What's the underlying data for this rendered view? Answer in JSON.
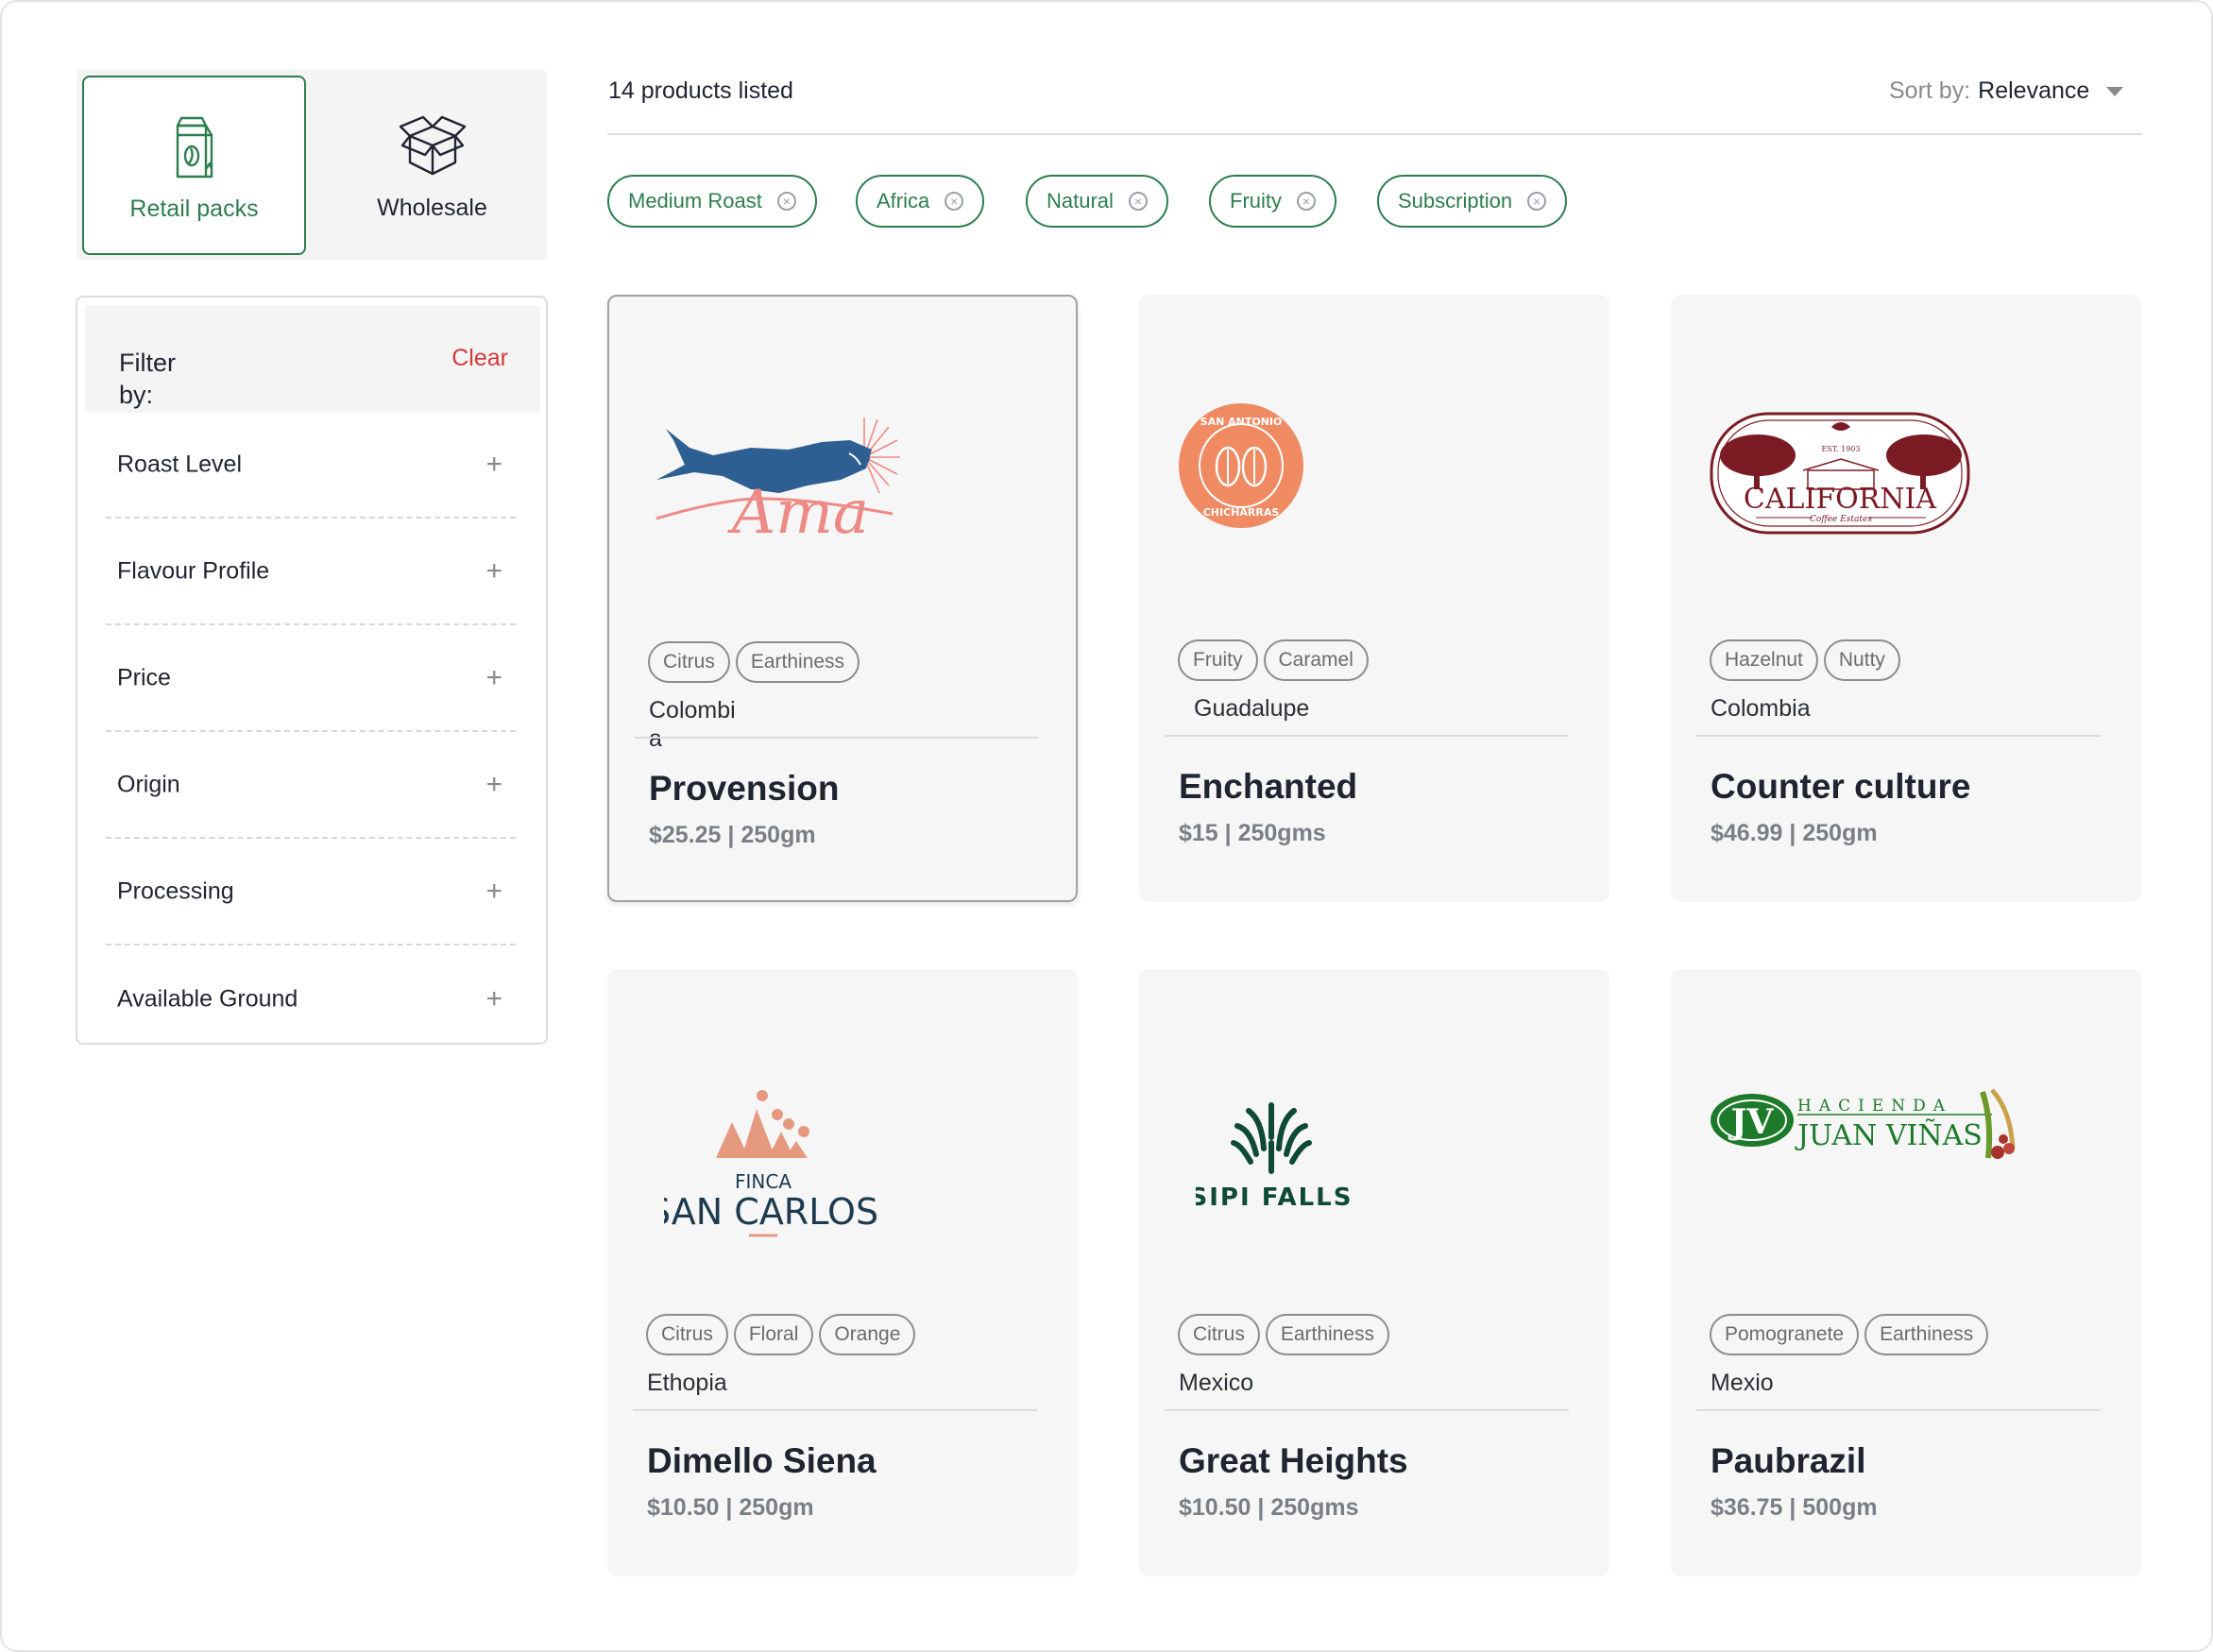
{
  "toggle": {
    "retail_label": "Retail packs",
    "wholesale_label": "Wholesale"
  },
  "filter": {
    "title": "Filter by:",
    "clear_label": "Clear",
    "items": [
      {
        "label": "Roast Level"
      },
      {
        "label": "Flavour Profile"
      },
      {
        "label": "Price"
      },
      {
        "label": "Origin"
      },
      {
        "label": "Processing"
      },
      {
        "label": "Available Ground"
      }
    ],
    "expand_icon": "+"
  },
  "results": {
    "count_text": "14 products listed",
    "sort_label": "Sort by:",
    "sort_value": "Relevance"
  },
  "active_filters": [
    {
      "label": "Medium Roast"
    },
    {
      "label": "Africa"
    },
    {
      "label": "Natural"
    },
    {
      "label": "Fruity"
    },
    {
      "label": "Subscription"
    }
  ],
  "products": [
    {
      "name": "Provension",
      "price": "$25.25 | 250gm",
      "origin": "Colombia",
      "tags": [
        "Citrus",
        "Earthiness"
      ],
      "logo": "ama-logo",
      "selected": true
    },
    {
      "name": "Enchanted",
      "price": "$15 | 250gms",
      "origin": "Guadalupe",
      "tags": [
        "Fruity",
        "Caramel"
      ],
      "logo": "san-antonio-chicharras-logo"
    },
    {
      "name": "Counter culture",
      "price": "$46.99 | 250gm",
      "origin": "Colombia",
      "tags": [
        "Hazelnut",
        "Nutty"
      ],
      "logo": "california-coffee-estates-logo"
    },
    {
      "name": "Dimello Siena",
      "price": "$10.50 | 250gm",
      "origin": "Ethopia",
      "tags": [
        "Citrus",
        "Floral",
        "Orange"
      ],
      "logo": "finca-san-carlos-logo"
    },
    {
      "name": "Great Heights",
      "price": "$10.50 | 250gms",
      "origin": "Mexico",
      "tags": [
        "Citrus",
        "Earthiness"
      ],
      "logo": "sipi-falls-logo"
    },
    {
      "name": "Paubrazil",
      "price": "$36.75 | 500gm",
      "origin": "Mexio",
      "tags": [
        "Pomogranete",
        "Earthiness"
      ],
      "logo": "hacienda-juan-vinas-logo"
    }
  ],
  "logos": {
    "ama": "Ama",
    "san_antonio_top": "SAN ANTONIO",
    "san_antonio_bottom": "CHICHARRAS",
    "california": "CALIFORNIA",
    "california_est": "EST. 1903",
    "california_sub": "Coffee Estates",
    "finca": "FINCA",
    "san_carlos": "SAN CARLOS",
    "sipi": "SIPI FALLS",
    "hacienda": "HACIENDA",
    "juan_vinas": "JUAN VIÑAS",
    "jv": "JV"
  },
  "colors": {
    "accent": "#2e7d4f",
    "clear": "#d33a3a"
  }
}
